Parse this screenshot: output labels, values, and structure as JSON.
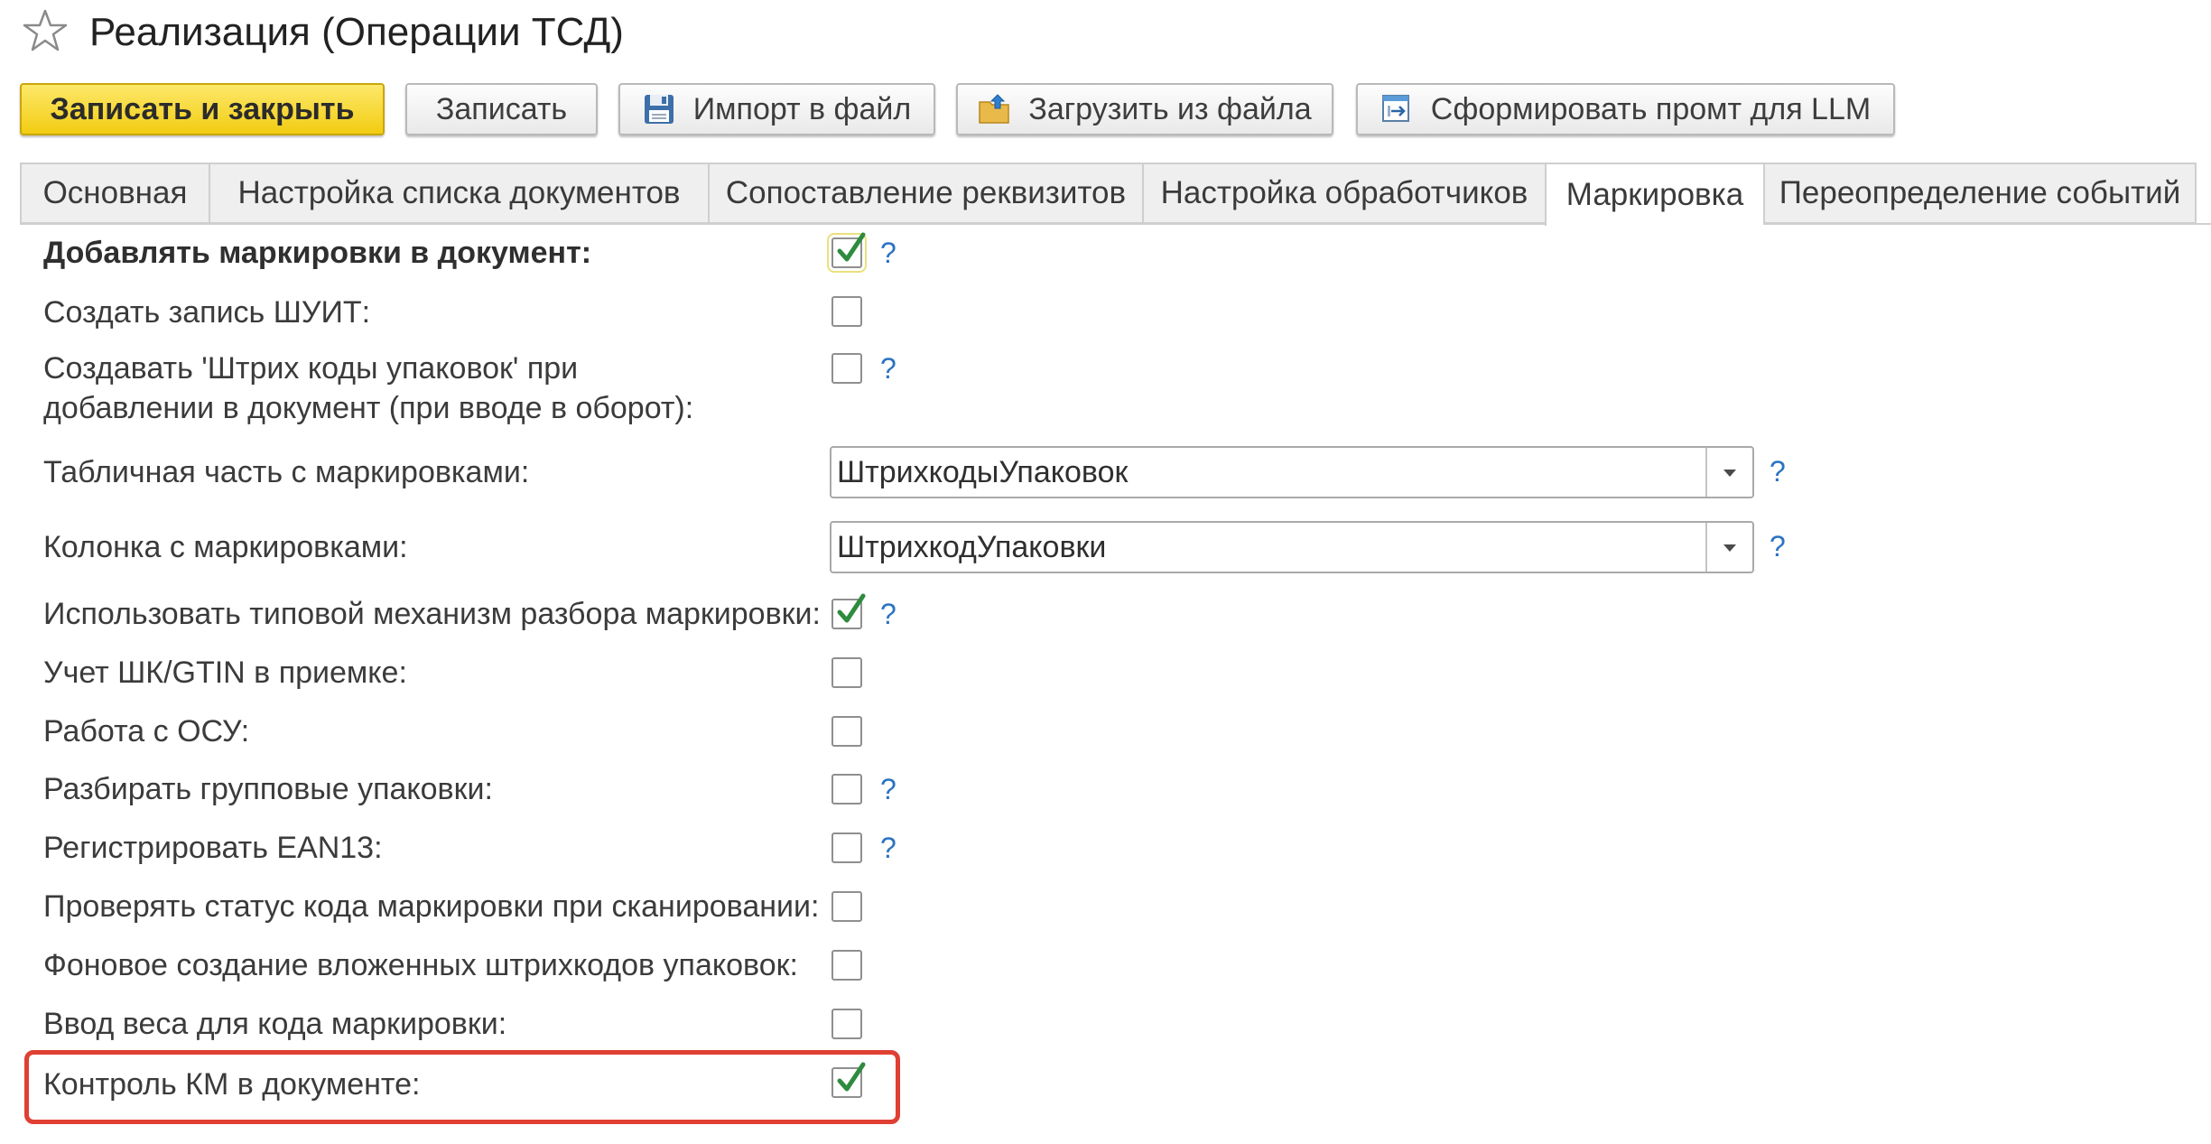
{
  "window": {
    "title": "Реализация (Операции ТСД)",
    "favorite_icon": "star-icon"
  },
  "toolbar": {
    "save_close_label": "Записать и закрыть",
    "save_label": "Записать",
    "import_label": "Импорт в файл",
    "import_icon": "floppy-disk-icon",
    "load_label": "Загрузить из файла",
    "load_icon": "folder-upload-icon",
    "prompt_label": "Сформировать промт для LLM",
    "prompt_icon": "form-export-icon"
  },
  "tabs": [
    {
      "label": "Основная",
      "active": false
    },
    {
      "label": "Настройка списка документов",
      "active": false
    },
    {
      "label": "Сопоставление реквизитов",
      "active": false
    },
    {
      "label": "Настройка обработчиков",
      "active": false
    },
    {
      "label": "Маркировка",
      "active": true
    },
    {
      "label": "Переопределение событий",
      "active": false
    }
  ],
  "form": {
    "help_text": "?",
    "fields": [
      {
        "label": "Добавлять маркировки в документ:",
        "checked": true
      },
      {
        "label": "Создать запись ШУИТ:",
        "checked": false
      },
      {
        "label_line1": "Создавать 'Штрих коды упаковок' при",
        "label_line2": "добавлении в документ (при вводе в оборот):",
        "checked": false
      },
      {
        "label": "Табличная часть с маркировками:",
        "value": "ШтрихкодыУпаковок"
      },
      {
        "label": "Колонка с маркировками:",
        "value": "ШтрихкодУпаковки"
      },
      {
        "label": "Использовать типовой механизм разбора маркировки:",
        "checked": true
      },
      {
        "label": "Учет ШК/GTIN в приемке:",
        "checked": false
      },
      {
        "label": "Работа с ОСУ:",
        "checked": false
      },
      {
        "label": "Разбирать групповые упаковки:",
        "checked": false
      },
      {
        "label": "Регистрировать EAN13:",
        "checked": false
      },
      {
        "label": "Проверять статус кода маркировки при сканировании:",
        "checked": false
      },
      {
        "label": "Фоновое создание вложенных штрихкодов упаковок:",
        "checked": false
      },
      {
        "label": "Ввод веса для кода маркировки:",
        "checked": false
      },
      {
        "label": "Контроль КМ в документе:",
        "checked": true,
        "highlighted": true
      }
    ]
  },
  "colors": {
    "primary_button": "#f2cc12",
    "checkmark": "#2e8b3d",
    "help_link": "#2b73c2",
    "highlight": "#e03f33"
  }
}
